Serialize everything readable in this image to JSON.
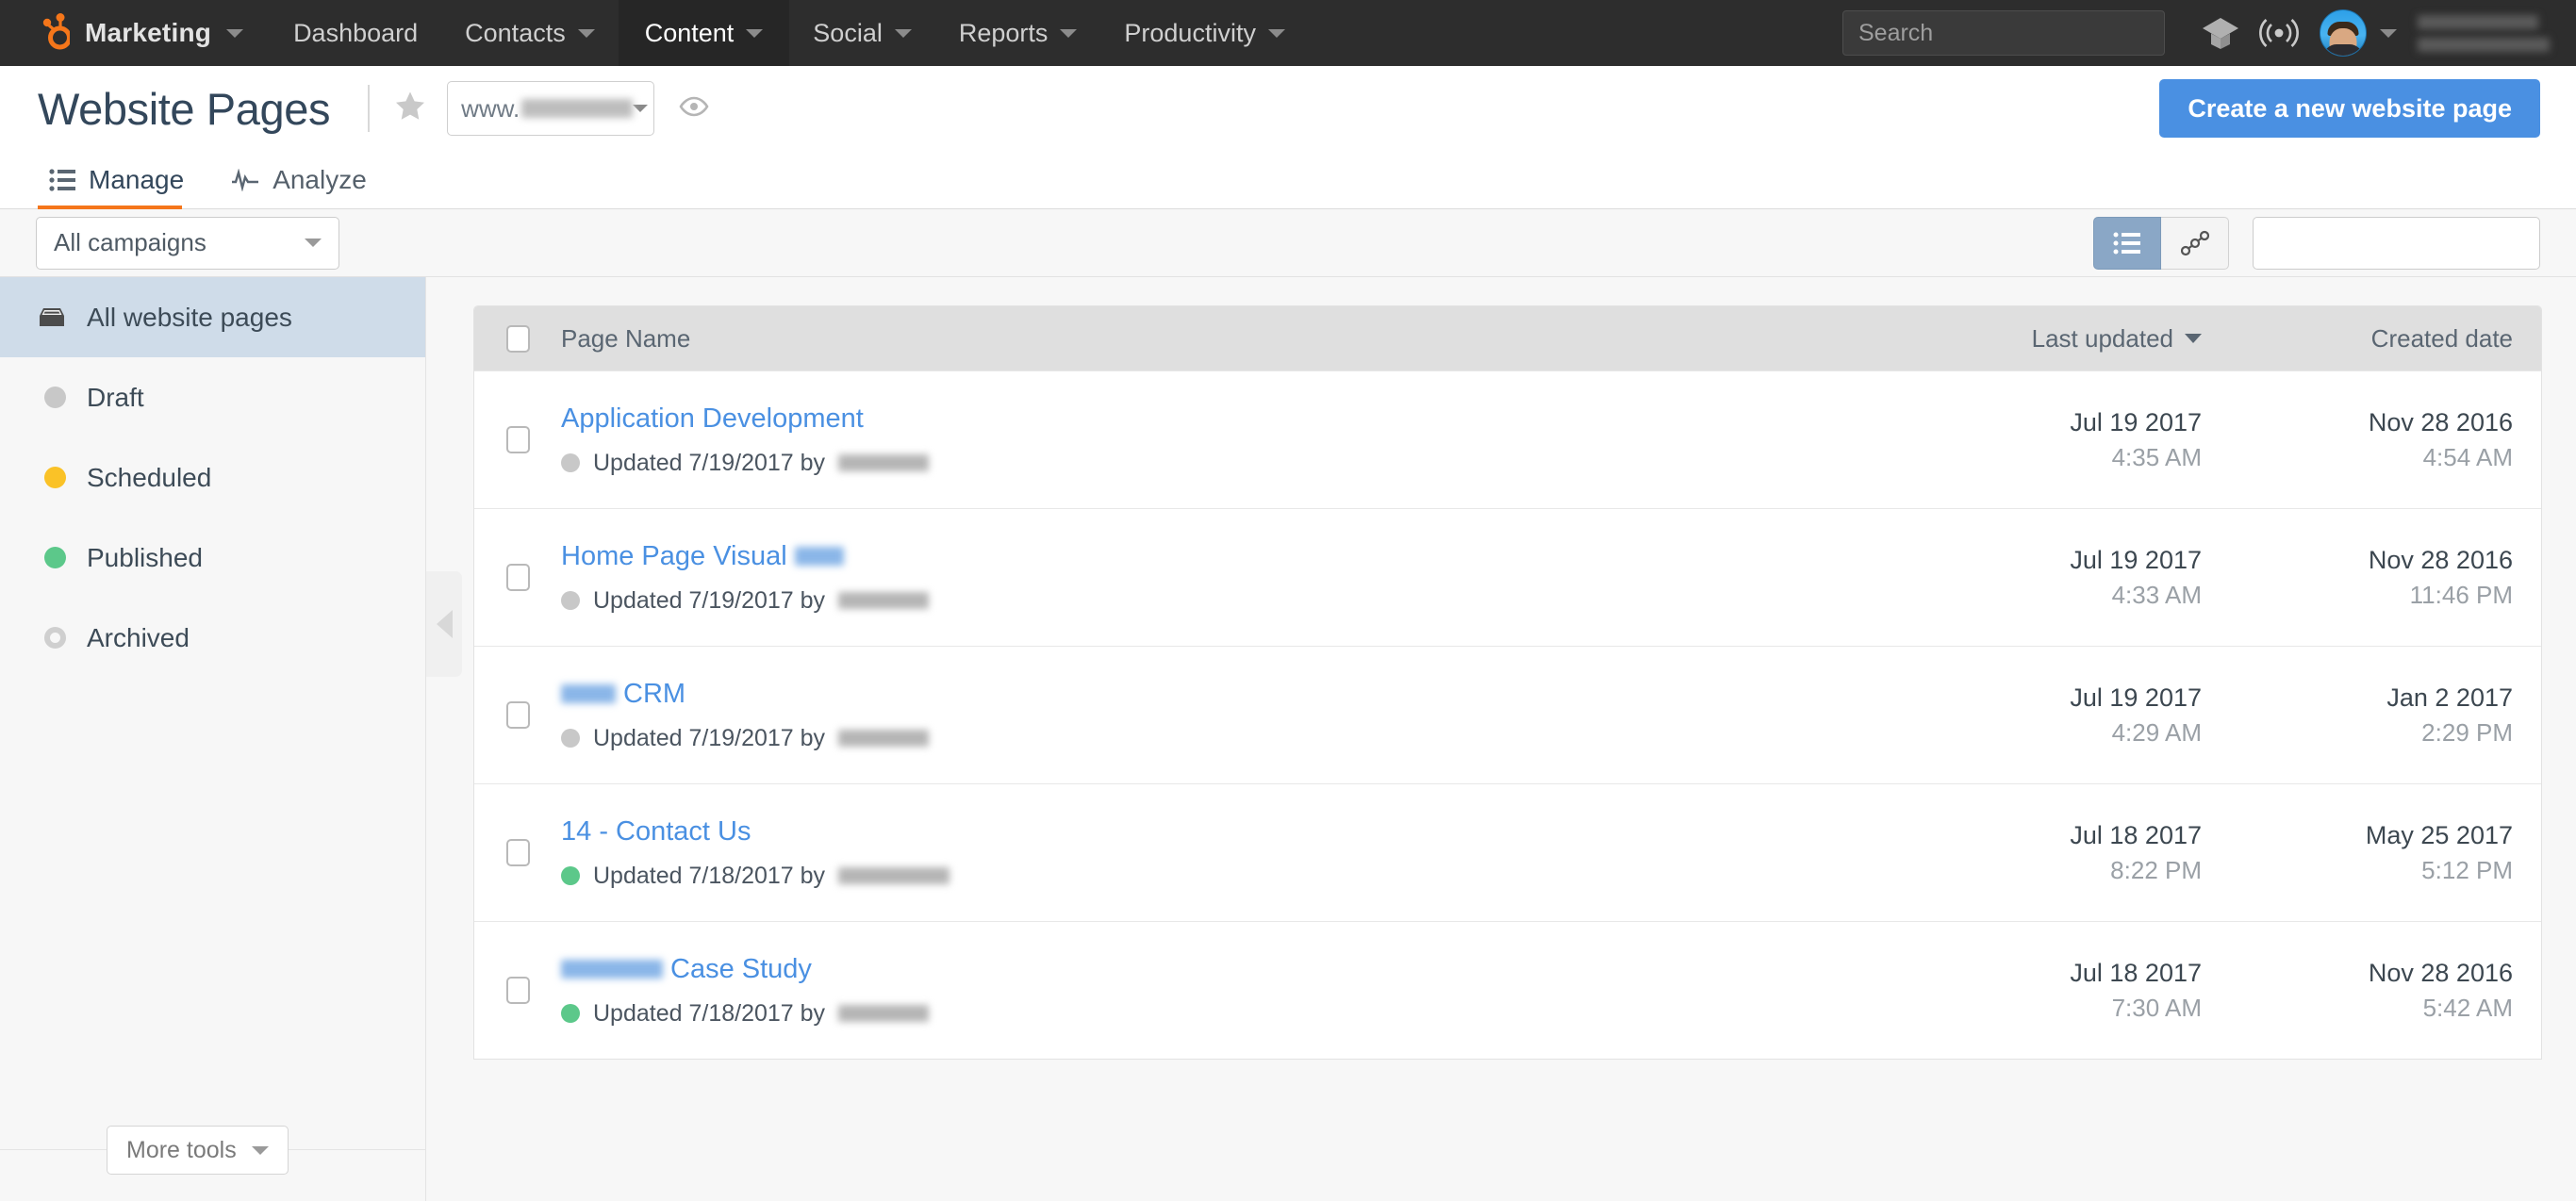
{
  "topnav": {
    "brand": "Marketing",
    "search_placeholder": "Search",
    "items": [
      {
        "label": "Dashboard",
        "has_caret": false,
        "active": false
      },
      {
        "label": "Contacts",
        "has_caret": true,
        "active": false
      },
      {
        "label": "Content",
        "has_caret": true,
        "active": true
      },
      {
        "label": "Social",
        "has_caret": true,
        "active": false
      },
      {
        "label": "Reports",
        "has_caret": true,
        "active": false
      },
      {
        "label": "Productivity",
        "has_caret": true,
        "active": false
      }
    ],
    "icons": [
      "academy-cap-icon",
      "notifications-broadcast-icon",
      "avatar",
      "chevron-down-icon"
    ]
  },
  "header": {
    "title": "Website Pages",
    "domain_prefix": "www.",
    "create_button": "Create a new website page",
    "icons": [
      "star-icon",
      "eye-icon",
      "chevron-down-icon"
    ]
  },
  "tabs": [
    {
      "label": "Manage",
      "icon": "list-icon",
      "active": true
    },
    {
      "label": "Analyze",
      "icon": "pulse-icon",
      "active": false
    }
  ],
  "filterbar": {
    "campaign_filter": "All campaigns",
    "search_value": "",
    "search_placeholder": "",
    "view_list_icon": "list-view-icon",
    "view_tree_icon": "tree-view-icon",
    "list_view_active": true
  },
  "sidebar": {
    "items": [
      {
        "label": "All website pages",
        "icon": "inbox-tray-icon",
        "active": true,
        "dot": null
      },
      {
        "label": "Draft",
        "icon": "status-dot",
        "active": false,
        "dot": "#c8c8c8"
      },
      {
        "label": "Scheduled",
        "icon": "status-dot",
        "active": false,
        "dot": "#fac227"
      },
      {
        "label": "Published",
        "icon": "status-dot",
        "active": false,
        "dot": "#5cc88a"
      },
      {
        "label": "Archived",
        "icon": "status-ring",
        "active": false,
        "dot": "ring"
      }
    ],
    "more_tools": "More tools",
    "collapse_icon": "chevron-left-icon"
  },
  "table": {
    "columns": {
      "name": "Page Name",
      "last_updated": "Last updated",
      "created_date": "Created date"
    },
    "sort_column": "Last updated",
    "sort_direction": "desc",
    "rows": [
      {
        "name": "Application Development",
        "name_blurred_suffix": false,
        "name_blurred_prefix": false,
        "status_color": "#c8c8c8",
        "updated_text": "Updated 7/19/2017 by",
        "updated_date": "Jul 19 2017",
        "updated_time": "4:35 AM",
        "created_date": "Nov 28 2016",
        "created_time": "4:54 AM"
      },
      {
        "name": "Home Page Visual",
        "name_blurred_suffix": true,
        "name_blurred_prefix": false,
        "status_color": "#c8c8c8",
        "updated_text": "Updated 7/19/2017 by",
        "updated_date": "Jul 19 2017",
        "updated_time": "4:33 AM",
        "created_date": "Nov 28 2016",
        "created_time": "11:46 PM"
      },
      {
        "name": "CRM",
        "name_blurred_suffix": false,
        "name_blurred_prefix": true,
        "status_color": "#c8c8c8",
        "updated_text": "Updated 7/19/2017 by",
        "updated_date": "Jul 19 2017",
        "updated_time": "4:29 AM",
        "created_date": "Jan 2 2017",
        "created_time": "2:29 PM"
      },
      {
        "name": "14 - Contact Us",
        "name_blurred_suffix": false,
        "name_blurred_prefix": false,
        "status_color": "#5cc88a",
        "updated_text": "Updated 7/18/2017 by",
        "updated_date": "Jul 18 2017",
        "updated_time": "8:22 PM",
        "created_date": "May 25 2017",
        "created_time": "5:12 PM"
      },
      {
        "name": "Case Study",
        "name_blurred_suffix": false,
        "name_blurred_prefix": true,
        "status_color": "#5cc88a",
        "updated_text": "Updated 7/18/2017 by",
        "updated_date": "Jul 18 2017",
        "updated_time": "7:30 AM",
        "created_date": "Nov 28 2016",
        "created_time": "5:42 AM"
      }
    ]
  },
  "colors": {
    "brand_orange": "#f5761a",
    "link_blue": "#4a90e2",
    "nav_dark": "#2d2d2d",
    "status_draft": "#c8c8c8",
    "status_scheduled": "#fac227",
    "status_published": "#5cc88a"
  }
}
